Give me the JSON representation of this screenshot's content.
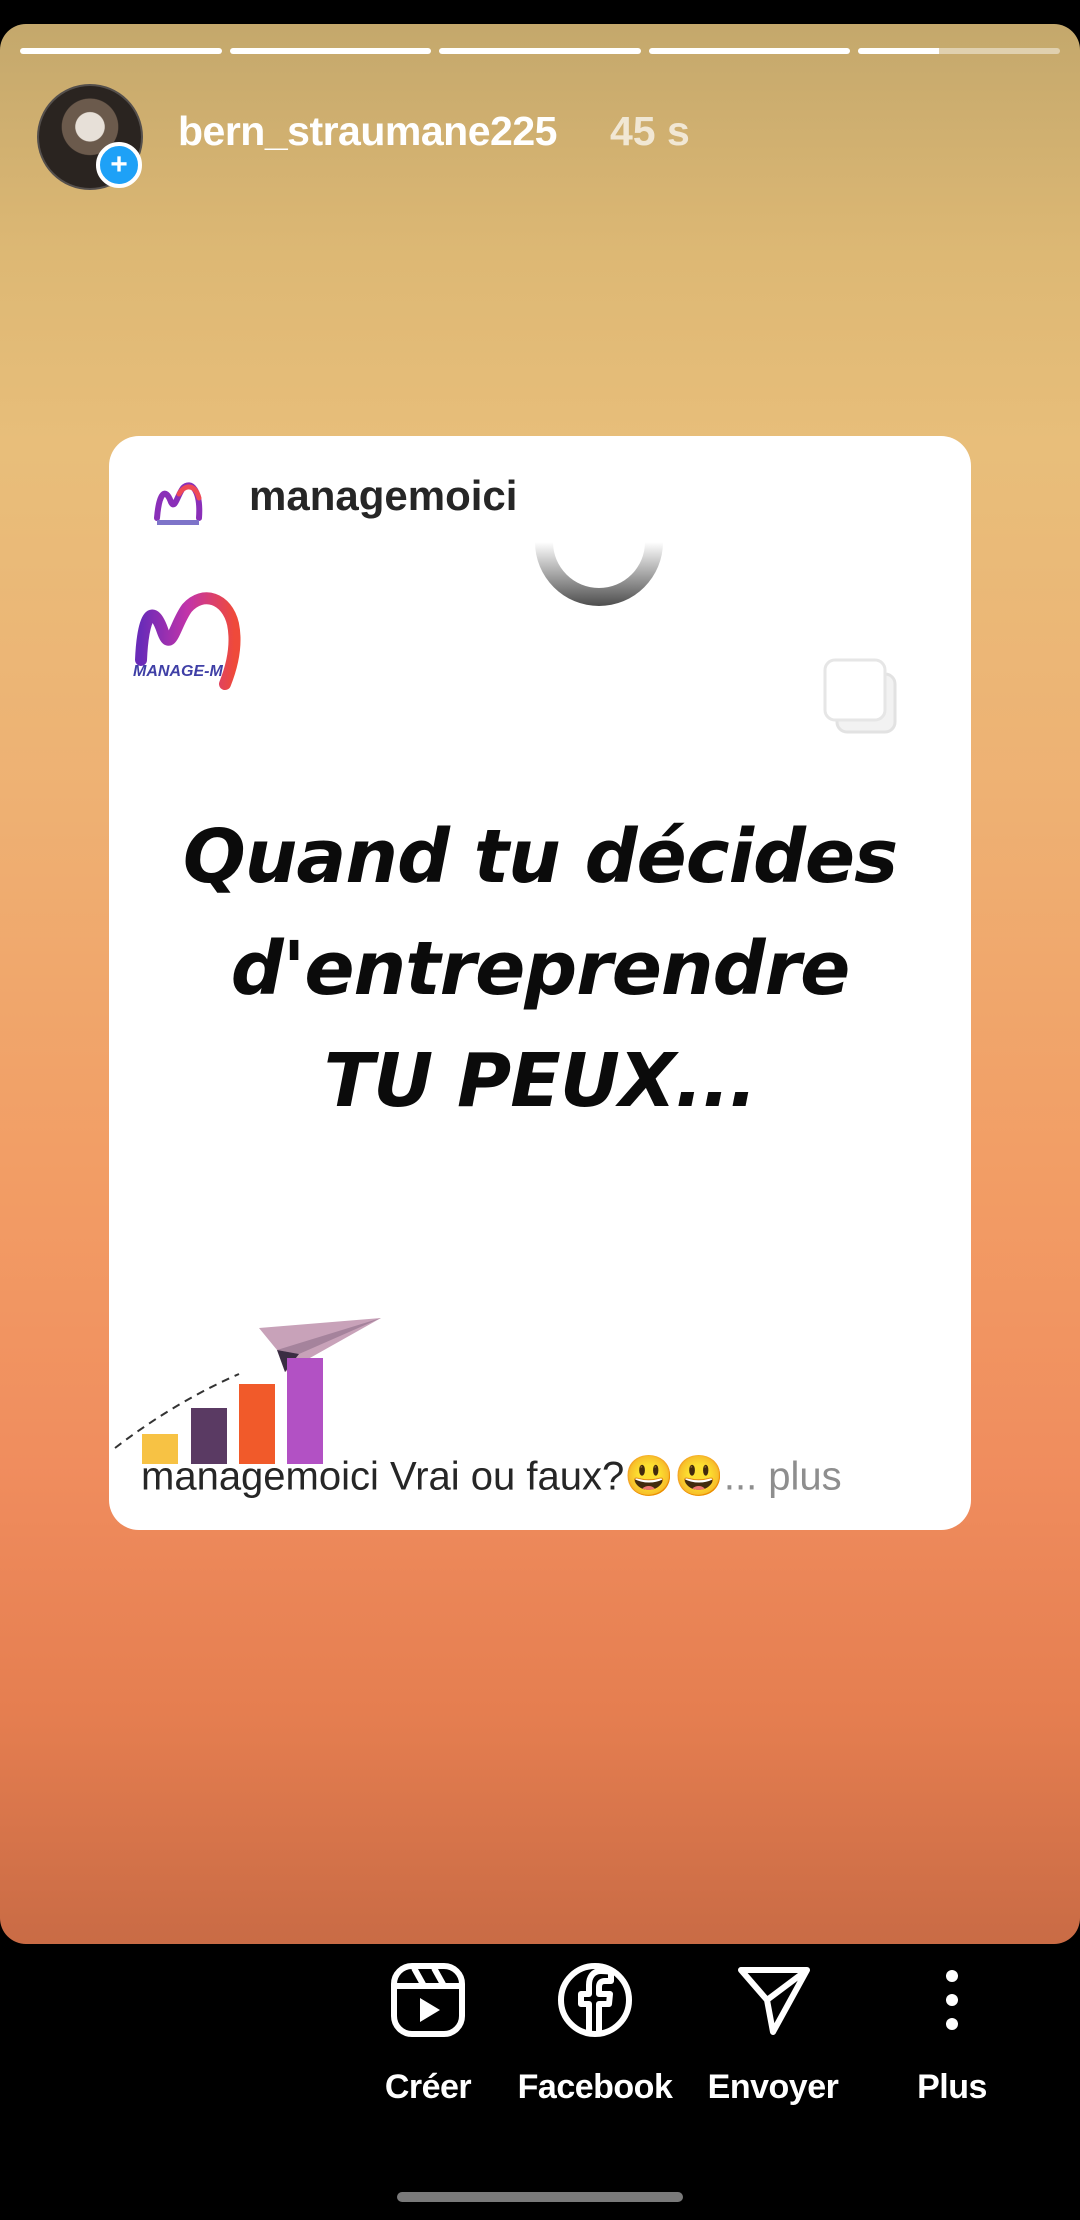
{
  "story": {
    "username": "bern_straumane225",
    "time": "45 s",
    "progress": [
      1,
      1,
      1,
      1,
      0.4
    ]
  },
  "post": {
    "author": "managemoici",
    "logo_text": "MANAGE-M",
    "headline": [
      "Quand tu décides",
      "d'entreprendre",
      "TU PEUX..."
    ],
    "caption_user": "managemoici",
    "caption_text": "Vrai ou faux?",
    "caption_emojis": "😃😃",
    "caption_more": "... plus"
  },
  "actions": [
    {
      "label": "Créer",
      "icon": "reels-icon"
    },
    {
      "label": "Facebook",
      "icon": "facebook-icon"
    },
    {
      "label": "Envoyer",
      "icon": "send-icon"
    },
    {
      "label": "Plus",
      "icon": "more-vertical-icon"
    }
  ],
  "colors": {
    "gradient_top": "#c4a86c",
    "gradient_mid": "#eeb173",
    "gradient_bottom": "#c96b45",
    "plus_badge": "#1ea1f7",
    "bar_yellow": "#f7c244",
    "bar_purple": "#5a3a63",
    "bar_orange": "#f15a2a",
    "bar_violet": "#b251c4"
  }
}
